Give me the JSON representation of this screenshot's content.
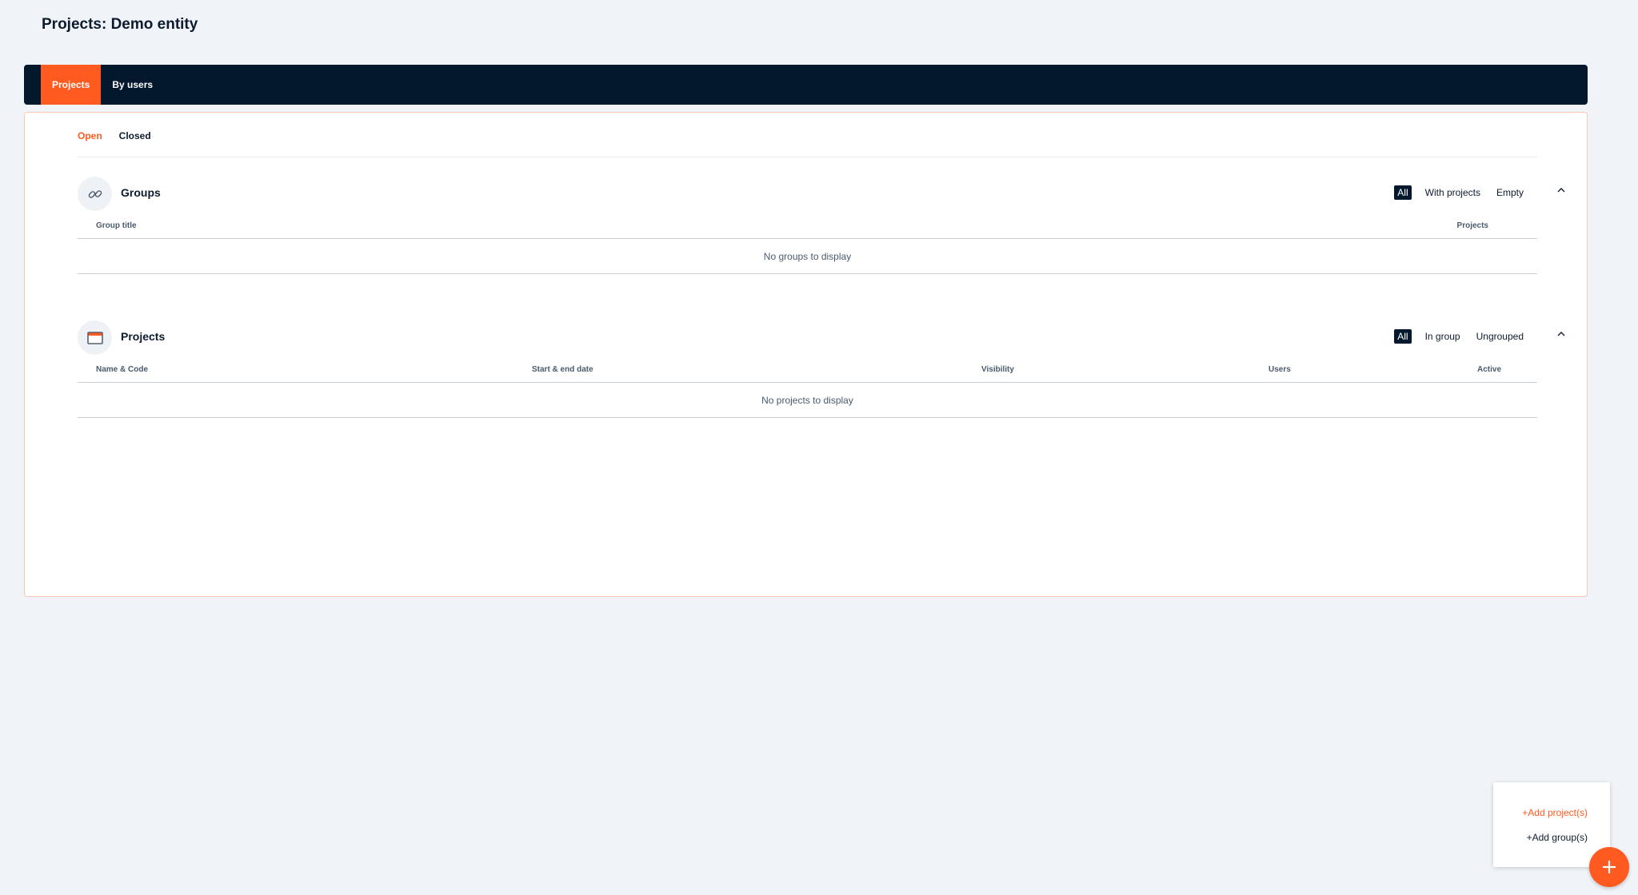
{
  "page": {
    "title": "Projects: Demo entity"
  },
  "topnav": {
    "tabs": [
      {
        "label": "Projects",
        "active": true
      },
      {
        "label": "By users",
        "active": false
      }
    ]
  },
  "subtabs": [
    {
      "label": "Open",
      "active": true
    },
    {
      "label": "Closed",
      "active": false
    }
  ],
  "groups": {
    "title": "Groups",
    "icon": "link-chain-icon",
    "filters": [
      {
        "label": "All",
        "active": true
      },
      {
        "label": "With projects"
      },
      {
        "label": "Empty"
      }
    ],
    "columns": [
      "Group title",
      "Projects"
    ],
    "empty_text": "No groups to display"
  },
  "projects": {
    "title": "Projects",
    "icon": "folder-window-icon",
    "filters": [
      {
        "label": "All",
        "active": true
      },
      {
        "label": "In group"
      },
      {
        "label": "Ungrouped"
      }
    ],
    "columns": [
      "Name & Code",
      "Start & end date",
      "Visibility",
      "Users",
      "Active"
    ],
    "empty_text": "No projects to display"
  },
  "add_menu": {
    "add_projects": "+Add project(s)",
    "add_groups": "+Add group(s)"
  },
  "colors": {
    "accent": "#ff5a1f",
    "nav_bg": "#03172d",
    "page_bg": "#f0f4f8"
  }
}
